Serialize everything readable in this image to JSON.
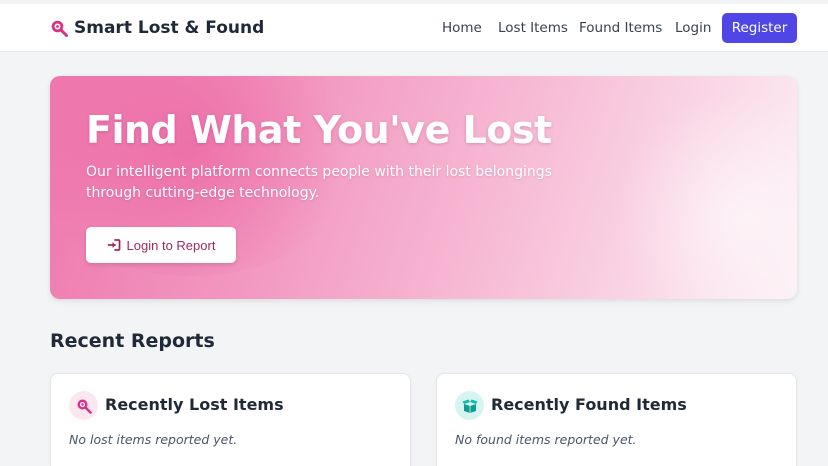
{
  "navbar": {
    "brand": "Smart Lost & Found",
    "brand_icon": "magnifier-icon",
    "links": [
      "Home",
      "Lost Items",
      "Found Items",
      "Login"
    ],
    "register_label": "Register"
  },
  "hero": {
    "title": "Find What You've Lost",
    "subtitle": "Our intelligent platform connects people with their lost belongings through cutting-edge technology.",
    "button_label": "Login to Report",
    "button_icon": "sign-in-icon"
  },
  "recent": {
    "title": "Recent Reports",
    "lost": {
      "title": "Recently Lost Items",
      "empty": "No lost items reported yet.",
      "icon": "magnifier-icon"
    },
    "found": {
      "title": "Recently Found Items",
      "empty": "No found items reported yet.",
      "icon": "box-open-icon"
    }
  },
  "colors": {
    "accent": "#4f46e5",
    "brand_pink": "#d63384",
    "hero_start": "#ee77ad",
    "hero_end": "#fcf0f5",
    "found_teal": "#0f9b8e"
  }
}
